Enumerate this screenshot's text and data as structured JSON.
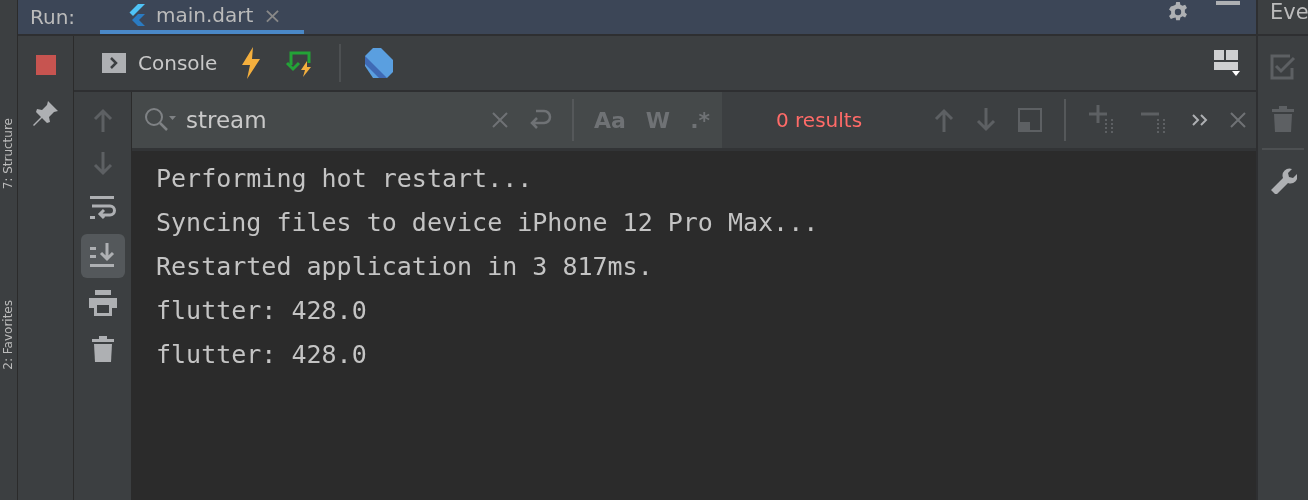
{
  "side_stripe": {
    "labels": [
      "7: Structure",
      "2: Favorites"
    ]
  },
  "run_bar": {
    "label": "Run:",
    "tabs": [
      {
        "label": "main.dart",
        "selected": true,
        "closable": "×"
      }
    ]
  },
  "events_panel": {
    "title": "Eve"
  },
  "toolbar": {
    "console_tab": "Console"
  },
  "search": {
    "value": "stream",
    "result": "0 results",
    "options": [
      "Aa",
      "W",
      ".*"
    ]
  },
  "scroll_to_end_active": true,
  "console": {
    "lines": [
      "Performing hot restart...",
      "Syncing files to device iPhone 12 Pro Max...",
      "Restarted application in 3 817ms.",
      "flutter: 428.0",
      "flutter: 428.0"
    ]
  }
}
